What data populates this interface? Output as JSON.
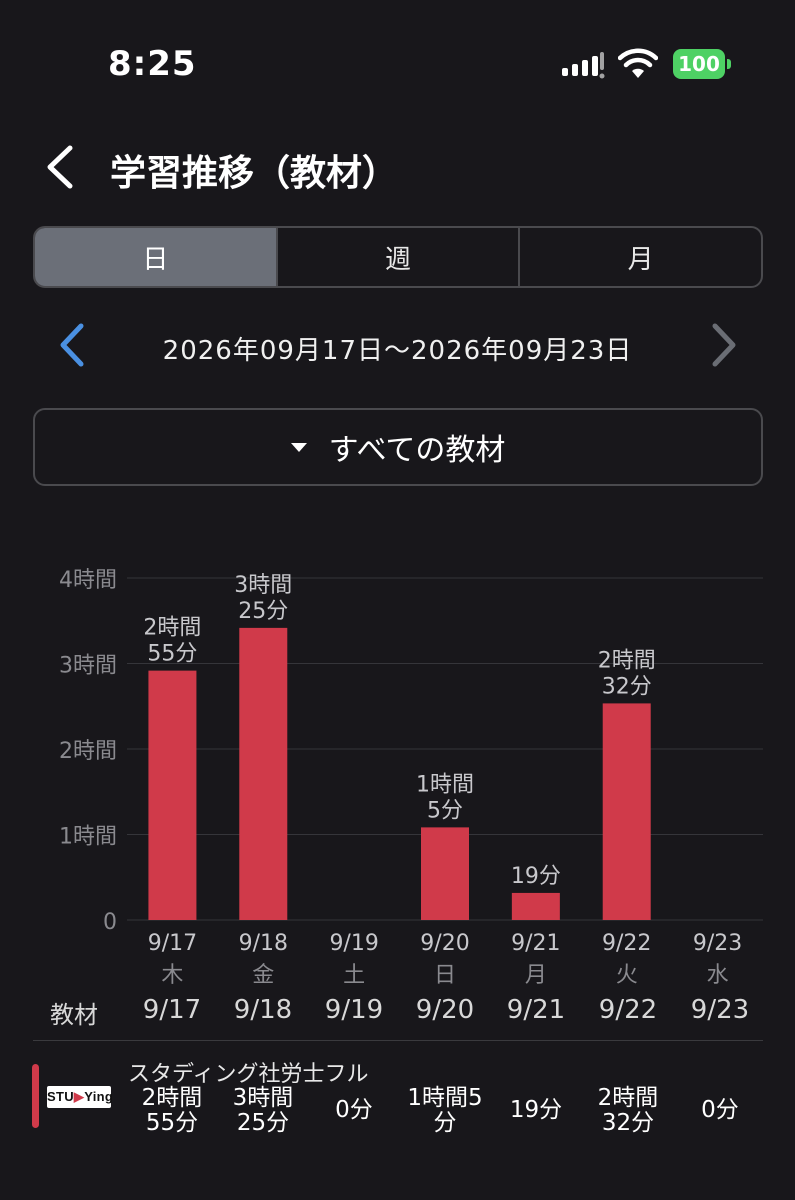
{
  "status_bar": {
    "time": "8:25",
    "battery": "100"
  },
  "header": {
    "title": "学習推移（教材）"
  },
  "segment": {
    "tabs": [
      "日",
      "週",
      "月"
    ],
    "active_index": 0
  },
  "date_nav": {
    "range": "2026年09月17日〜2026年09月23日"
  },
  "material_filter": {
    "label": "すべての教材"
  },
  "chart_data": {
    "type": "bar",
    "y_ticks": [
      "0",
      "1時間",
      "2時間",
      "3時間",
      "4時間"
    ],
    "ylim": [
      0,
      240
    ],
    "y_unit": "minutes",
    "categories": [
      "9/17",
      "9/18",
      "9/19",
      "9/20",
      "9/21",
      "9/22",
      "9/23"
    ],
    "weekdays": [
      "木",
      "金",
      "土",
      "日",
      "月",
      "火",
      "水"
    ],
    "values": [
      175,
      205,
      0,
      65,
      19,
      152,
      0
    ],
    "data_labels": [
      "2時間\n55分",
      "3時間\n25分",
      "",
      "1時間\n5分",
      "19分",
      "2時間\n32分",
      ""
    ],
    "bar_color": "#d03a4a",
    "grid": true
  },
  "table": {
    "header_label": "教材",
    "dates": [
      "9/17",
      "9/18",
      "9/19",
      "9/20",
      "9/21",
      "9/22",
      "9/23"
    ],
    "rows": [
      {
        "name": "スタディング社労士フル",
        "logo_text_left": "STU",
        "logo_text_right": "Ying",
        "color": "#d03a4a",
        "cells": [
          "2時間\n55分",
          "3時間\n25分",
          "0分",
          "1時間5\n分",
          "19分",
          "2時間\n32分",
          "0分"
        ]
      }
    ]
  }
}
